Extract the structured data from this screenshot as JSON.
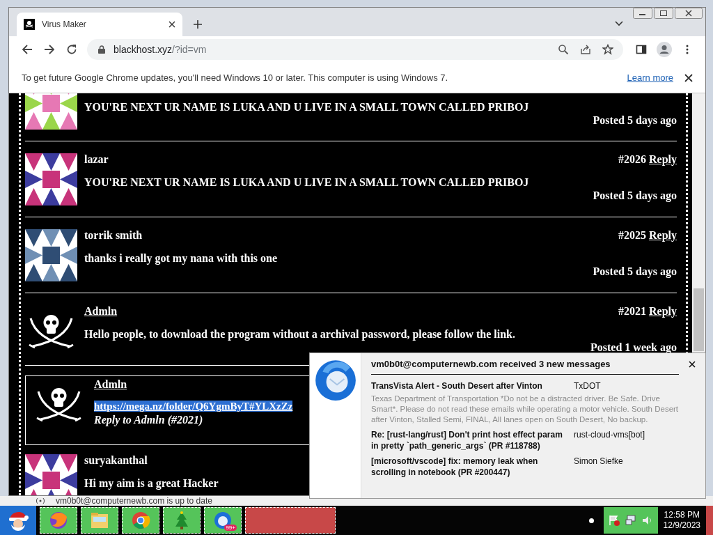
{
  "browser": {
    "tab": {
      "title": "Virus Maker",
      "selected": true
    },
    "url": {
      "host": "blackhost.xyz",
      "path": "/?id=vm"
    },
    "infobar": {
      "message": "To get future Google Chrome updates, you'll need Windows 10 or later. This computer is using Windows 7.",
      "link": "Learn more"
    }
  },
  "comments": [
    {
      "kind": "identicon",
      "text": "YOU'RE NEXT UR NAME IS LUKA AND U LIVE IN A SMALL TOWN CALLED PRIBOJ",
      "posted": "Posted 5 days ago"
    },
    {
      "kind": "identicon",
      "name": "lazar",
      "name_linked": false,
      "number": "#2026",
      "reply": "Reply",
      "text": "YOU'RE NEXT UR NAME IS LUKA AND U LIVE IN A SMALL TOWN CALLED PRIBOJ",
      "posted": "Posted 5 days ago"
    },
    {
      "kind": "identicon",
      "name": "torrik smith",
      "name_linked": false,
      "number": "#2025",
      "reply": "Reply",
      "text": "thanks i really got my nana with this one",
      "posted": "Posted 5 days ago"
    },
    {
      "kind": "pirate",
      "name": "Admln",
      "name_linked": true,
      "number": "#2021",
      "reply": "Reply",
      "text": "Hello people, to download the program without a archival password, please follow the link.",
      "posted": "Posted 1 week ago"
    },
    {
      "kind": "pirate",
      "nested": true,
      "name": "Admln",
      "name_linked": true,
      "link": {
        "text": "https://mega.nz/folder/Q6YgmByT#YLXzZz",
        "selected": true
      },
      "reply_to": "Reply to Admln (#2021)"
    },
    {
      "kind": "identicon",
      "name": "suryakanthal",
      "name_linked": false,
      "text": "Hi my aim is a great Hacker"
    }
  ],
  "mail_status": "vm0b0t@computernewb.com is up to date",
  "notification": {
    "title": "vm0b0t@computernewb.com received 3 new messages",
    "messages": [
      {
        "subject": "TransVista Alert - South Desert after Vinton",
        "sender": "TxDOT",
        "preview": "Texas Department of Transportation *Do not be a distracted driver. Be Safe. Drive Smart*. Please do not read these emails while operating a motor vehicle. South Desert after Vinton, Stalled Semi, FINAL, All lanes open on South Desert, No backup."
      },
      {
        "subject": "Re: [rust-lang/rust] Don't print host effect param in pretty `path_generic_args` (PR #118788)",
        "sender": "rust-cloud-vms[bot]"
      },
      {
        "subject": "[microsoft/vscode] fix: memory leak when scrolling in notebook (PR #200447)",
        "sender": "Simon Siefke"
      }
    ]
  },
  "taskbar": {
    "mail_badge": "99+",
    "time": "12:58 PM",
    "date": "12/9/2023"
  }
}
